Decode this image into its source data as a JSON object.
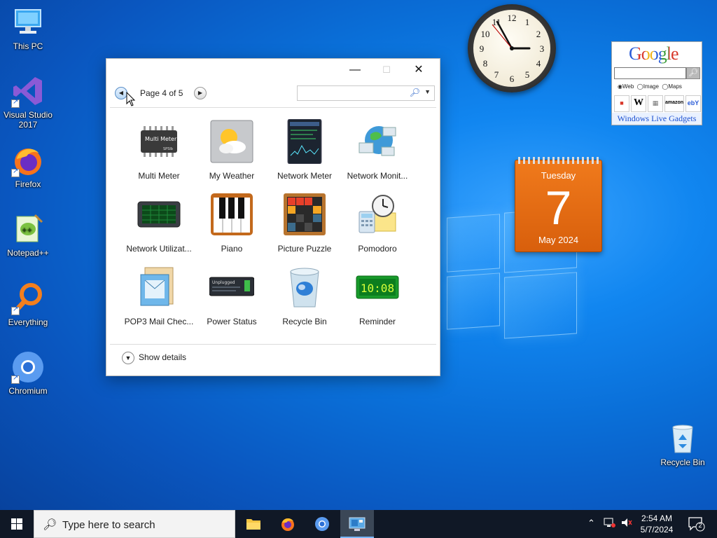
{
  "desktop": {
    "icons": [
      {
        "label": "This PC"
      },
      {
        "label": "Visual Studio\n2017"
      },
      {
        "label": "Firefox"
      },
      {
        "label": "Notepad++"
      },
      {
        "label": "Everything"
      },
      {
        "label": "Chromium"
      }
    ],
    "recycle_bin_label": "Recycle Bin"
  },
  "gallery": {
    "title_buttons": {
      "minimize": "—",
      "maximize": "☐",
      "close": "✕"
    },
    "page_label": "Page 4 of 5",
    "prev_arrow": "◀",
    "next_arrow": "▶",
    "search_placeholder": "",
    "gadgets": [
      {
        "name": "Multi Meter"
      },
      {
        "name": "My Weather"
      },
      {
        "name": "Network Meter"
      },
      {
        "name": "Network Monit..."
      },
      {
        "name": "Network Utilizat..."
      },
      {
        "name": "Piano"
      },
      {
        "name": "Picture Puzzle"
      },
      {
        "name": "Pomodoro"
      },
      {
        "name": "POP3 Mail Chec..."
      },
      {
        "name": "Power Status"
      },
      {
        "name": "Recycle Bin"
      },
      {
        "name": "Reminder"
      }
    ],
    "tile_text": {
      "multi_meter": "Multi Meter",
      "multi_meter_brand": "SPSlb",
      "power_status_text": "Unplugged",
      "reminder_time": "10:08"
    },
    "show_details": "Show details"
  },
  "clock": {
    "numbers": [
      "12",
      "1",
      "2",
      "3",
      "4",
      "5",
      "6",
      "7",
      "8",
      "9",
      "10",
      "11"
    ]
  },
  "google_gadget": {
    "logo": "Google",
    "radio_options": [
      "Web",
      "Image",
      "Maps"
    ],
    "links": [
      "W",
      "amazon",
      "ebY"
    ],
    "footer": "Windows Live Gadgets"
  },
  "calendar": {
    "weekday": "Tuesday",
    "day": "7",
    "month_year": "May 2024"
  },
  "taskbar": {
    "search_placeholder": "Type here to search",
    "time": "2:54 AM",
    "date": "5/7/2024",
    "notification_count": "2"
  },
  "colors": {
    "calendar": "#e46c14",
    "taskbar": "#101826",
    "desktop_blue": "#0a6fd8"
  }
}
